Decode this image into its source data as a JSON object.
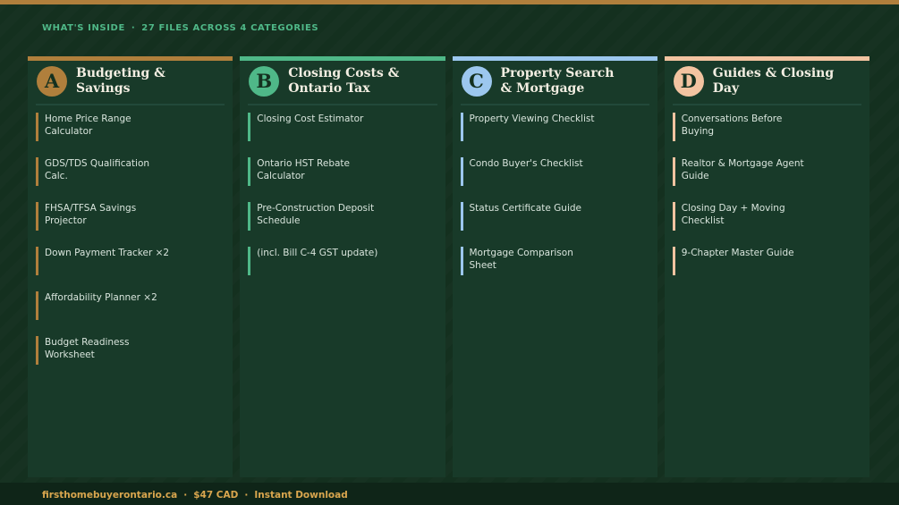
{
  "header": {
    "label": "WHAT'S INSIDE",
    "separator": "·",
    "summary": "27 FILES ACROSS 4 CATEGORIES"
  },
  "colors": {
    "background": "#14301f",
    "card": "#183a29",
    "header_text": "#4fb888",
    "footer_text": "#d9a64e",
    "top_stripe": "#b07f3c"
  },
  "categories": [
    {
      "letter": "A",
      "title": "Budgeting & Savings",
      "accent": "#b07f3c",
      "items": [
        "Home Price Range Calculator",
        "GDS/TDS Qualification Calc.",
        "FHSA/TFSA Savings Projector",
        "Down Payment Tracker ×2",
        "Affordability Planner ×2",
        "Budget Readiness Worksheet"
      ]
    },
    {
      "letter": "B",
      "title": "Closing Costs & Ontario Tax",
      "accent": "#4fb888",
      "items": [
        "Closing Cost Estimator",
        "Ontario HST Rebate Calculator",
        "Pre-Construction Deposit Schedule",
        "(incl. Bill C-4 GST update)"
      ]
    },
    {
      "letter": "C",
      "title": "Property Search & Mortgage",
      "accent": "#9cc7ee",
      "items": [
        "Property Viewing Checklist",
        "Condo Buyer's Checklist",
        "Status Certificate Guide",
        "Mortgage Comparison Sheet"
      ]
    },
    {
      "letter": "D",
      "title": "Guides & Closing Day",
      "accent": "#f2c3a0",
      "items": [
        "Conversations Before Buying",
        "Realtor & Mortgage Agent Guide",
        "Closing Day + Moving Checklist",
        "9-Chapter Master Guide"
      ]
    }
  ],
  "footer": {
    "site": "firsthomebuyerontario.ca",
    "separator": "·",
    "price": "$47 CAD",
    "delivery": "Instant Download"
  }
}
